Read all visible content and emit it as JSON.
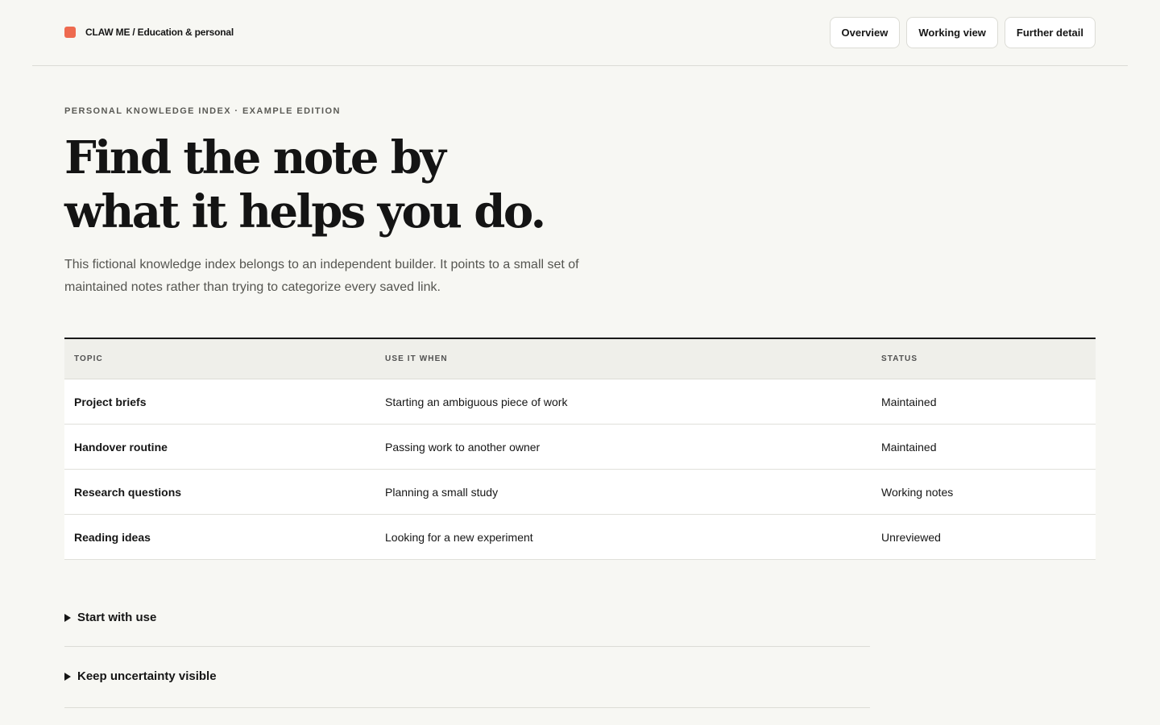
{
  "brand": {
    "name": "CLAW ME / Education & personal",
    "accent": "#ee6a4f"
  },
  "nav": {
    "items": [
      "Overview",
      "Working view",
      "Further detail"
    ]
  },
  "hero": {
    "eyebrow": "PERSONAL KNOWLEDGE INDEX · EXAMPLE EDITION",
    "headline_line1": "Find the note by",
    "headline_line2": "what it helps you do.",
    "lead": "This fictional knowledge index belongs to an independent builder. It points to a small set of maintained notes rather than trying to categorize every saved link."
  },
  "table": {
    "headers": [
      "TOPIC",
      "USE IT WHEN",
      "STATUS"
    ],
    "rows": [
      [
        "Project briefs",
        "Starting an ambiguous piece of work",
        "Maintained"
      ],
      [
        "Handover routine",
        "Passing work to another owner",
        "Maintained"
      ],
      [
        "Research questions",
        "Planning a small study",
        "Working notes"
      ],
      [
        "Reading ideas",
        "Looking for a new experiment",
        "Unreviewed"
      ]
    ]
  },
  "details": [
    {
      "summary": "Start with use",
      "icon": "caret-right-icon"
    },
    {
      "summary": "Keep uncertainty visible",
      "icon": "caret-right-icon"
    }
  ]
}
